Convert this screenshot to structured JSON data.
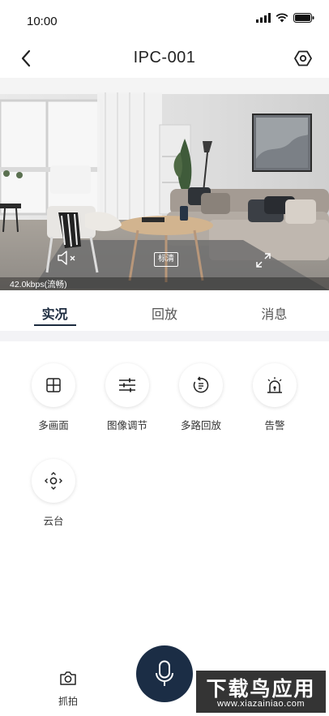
{
  "status_bar": {
    "time": "10:00"
  },
  "nav": {
    "title": "IPC-001"
  },
  "video": {
    "quality_label": "标清",
    "bitrate": "42.0kbps(流畅)"
  },
  "tabs": [
    {
      "label": "实况",
      "active": true
    },
    {
      "label": "回放",
      "active": false
    },
    {
      "label": "消息",
      "active": false
    }
  ],
  "functions": [
    {
      "label": "多画面",
      "icon": "multi-screen-icon"
    },
    {
      "label": "图像调节",
      "icon": "sliders-icon"
    },
    {
      "label": "多路回放",
      "icon": "playback-icon"
    },
    {
      "label": "告警",
      "icon": "alarm-icon"
    },
    {
      "label": "云台",
      "icon": "ptz-icon"
    }
  ],
  "bottom": {
    "snapshot_label": "抓拍",
    "mic_icon": "microphone-icon"
  },
  "watermark": {
    "main": "下载鸟应用",
    "sub": "www.xiazainiao.com"
  },
  "colors": {
    "accent": "#1c2b3f",
    "mic_bg": "#1b2d45",
    "divider": "#f3f3f6"
  }
}
